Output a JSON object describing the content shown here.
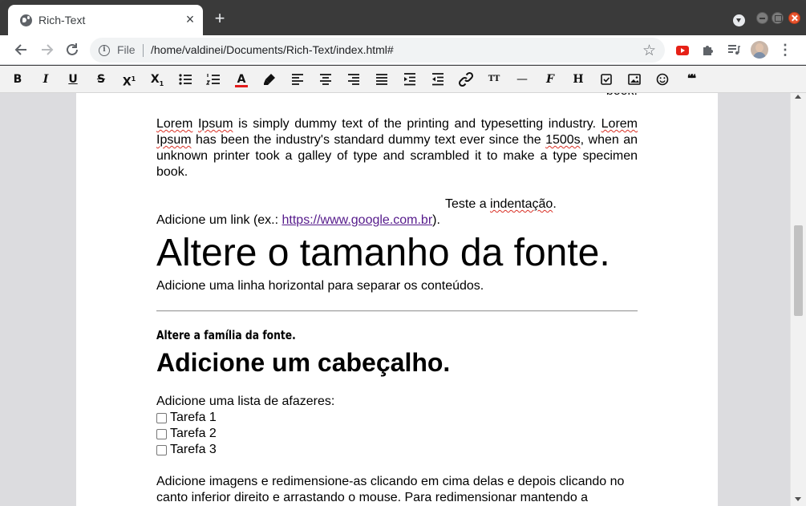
{
  "browser": {
    "tab_title": "Rich-Text",
    "tab_close": "×",
    "new_tab": "+",
    "file_label": "File",
    "url": "/home/valdinei/Documents/Rich-Text/index.html#"
  },
  "editor_toolbar": {
    "bold": "B",
    "italic": "I",
    "underline": "U",
    "strike": "S",
    "superscript_base": "X",
    "superscript_mark": "1",
    "subscript_base": "X",
    "subscript_mark": "1",
    "text_color": "A",
    "font_size": "TT",
    "horizontal_rule": "—",
    "font_family": "F",
    "heading": "H",
    "quote": "❝❝"
  },
  "document": {
    "cut_top": "book.",
    "paragraph": {
      "w1": "Lorem",
      "w2": "Ipsum",
      "t1": " is simply dummy text of the printing and typesetting industry. ",
      "w3": "Lorem",
      "t2": " ",
      "w4": "Ipsum",
      "t3": " has been the industry's standard dummy text ever since the ",
      "w5": "1500s",
      "t4": ", when an unknown printer took a galley of type and scrambled it to make a type specimen book."
    },
    "indent": {
      "before": "Teste a ",
      "word": "indentação",
      "after": "."
    },
    "link_line": {
      "before": "Adicione um link (ex.: ",
      "link": "https://www.google.com.br",
      "after": ")."
    },
    "font_size_text": "Altere o tamanho da fonte.",
    "hr_text": "Adicione uma linha horizontal para separar os conteúdos.",
    "font_family_text": "Altere a família da fonte.",
    "heading_text": "Adicione um cabeçalho.",
    "todo_title": "Adicione uma lista de afazeres:",
    "todos": [
      "Tarefa 1",
      "Tarefa 2",
      "Tarefa 3"
    ],
    "images_text": "Adicione imagens e redimensione-as clicando em cima delas e depois clicando no canto inferior direito e arrastando o mouse. Para redimensionar mantendo a"
  },
  "colors": {
    "text_color_swatch": "#e31b1b",
    "link": "#551a8b",
    "close_button": "#e8542e"
  }
}
